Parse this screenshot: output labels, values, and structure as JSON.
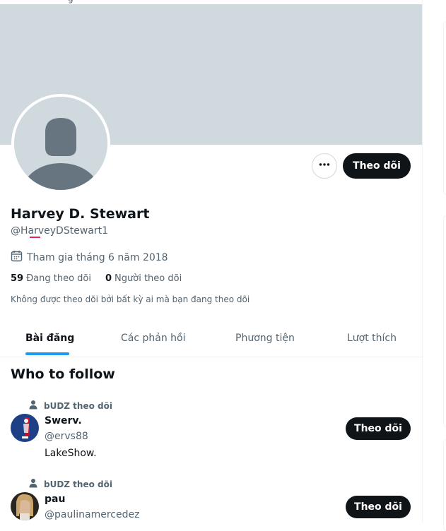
{
  "top_strip": {
    "text": "g"
  },
  "profile": {
    "display_name": "Harvey D. Stewart",
    "handle": "@HarveyDStewart1",
    "joined": "Tham gia tháng 6 năm 2018",
    "following_count": "59",
    "following_label": "Đang theo dõi",
    "followers_count": "0",
    "followers_label": "Người theo dõi",
    "not_followed_note": "Không được theo dõi bởi bất kỳ ai mà bạn đang theo dõi",
    "follow_label": "Theo dõi",
    "more_label": "..."
  },
  "tabs": [
    {
      "label": "Bài đăng",
      "active": true
    },
    {
      "label": "Các phản hồi",
      "active": false
    },
    {
      "label": "Phương tiện",
      "active": false
    },
    {
      "label": "Lượt thích",
      "active": false
    }
  ],
  "who_to_follow": {
    "title": "Who to follow",
    "users": [
      {
        "context": "bUDZ theo dõi",
        "name": "Swerv.",
        "handle": "@ervs88",
        "bio": "LakeShow.",
        "follow_label": "Theo dõi"
      },
      {
        "context": "bUDZ theo dõi",
        "name": "pau",
        "handle": "@paulinamercedez",
        "bio": "",
        "follow_label": "Theo dõi"
      }
    ]
  },
  "colors": {
    "banner": "#cfd9de",
    "accent": "#1d9bf0",
    "button_bg": "#0f1419",
    "secondary_text": "#536471"
  },
  "icons": {
    "calendar": "calendar-icon",
    "more": "more-horizontal-icon",
    "person": "person-icon"
  }
}
